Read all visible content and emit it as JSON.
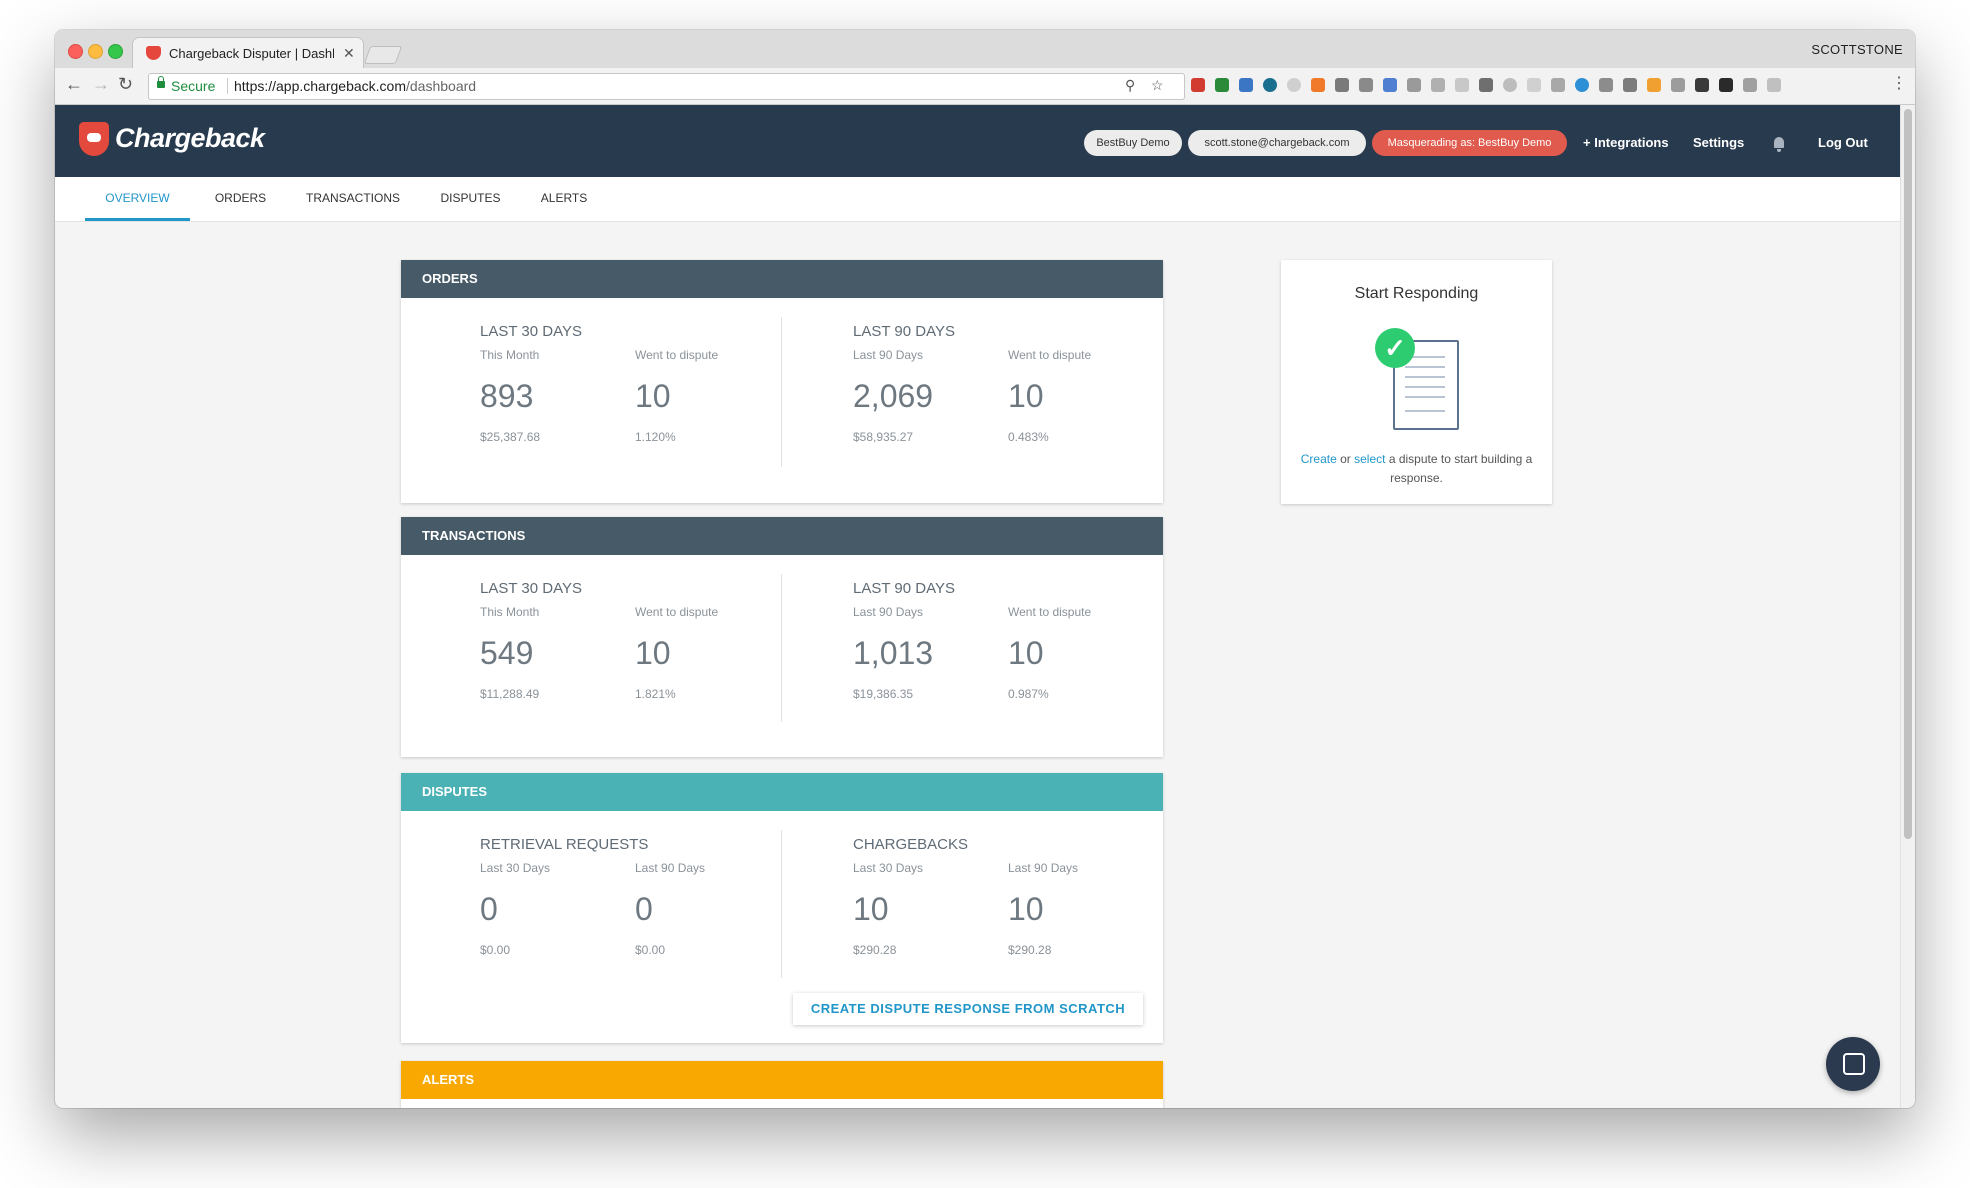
{
  "browser": {
    "tab_title": "Chargeback Disputer | Dashboard",
    "profile_name": "SCOTTSTONE",
    "secure_label": "Secure",
    "url_host": "https://app.chargeback.com",
    "url_path": "/dashboard"
  },
  "header": {
    "logo_text": "Chargeback",
    "pill_account": "BestBuy Demo",
    "pill_email": "scott.stone@chargeback.com",
    "pill_masquerade": "Masquerading as: BestBuy Demo",
    "integrations": "+ Integrations",
    "settings": "Settings",
    "logout": "Log Out"
  },
  "tabs": [
    "OVERVIEW",
    "ORDERS",
    "TRANSACTIONS",
    "DISPUTES",
    "ALERTS"
  ],
  "orders": {
    "header": "ORDERS",
    "left": {
      "title": "LAST 30 DAYS",
      "col1_label": "This Month",
      "col1_value": "893",
      "col1_sub": "$25,387.68",
      "col2_label": "Went to dispute",
      "col2_value": "10",
      "col2_sub": "1.120%"
    },
    "right": {
      "title": "LAST 90 DAYS",
      "col1_label": "Last 90 Days",
      "col1_value": "2,069",
      "col1_sub": "$58,935.27",
      "col2_label": "Went to dispute",
      "col2_value": "10",
      "col2_sub": "0.483%"
    }
  },
  "transactions": {
    "header": "TRANSACTIONS",
    "left": {
      "title": "LAST 30 DAYS",
      "col1_label": "This Month",
      "col1_value": "549",
      "col1_sub": "$11,288.49",
      "col2_label": "Went to dispute",
      "col2_value": "10",
      "col2_sub": "1.821%"
    },
    "right": {
      "title": "LAST 90 DAYS",
      "col1_label": "Last 90 Days",
      "col1_value": "1,013",
      "col1_sub": "$19,386.35",
      "col2_label": "Went to dispute",
      "col2_value": "10",
      "col2_sub": "0.987%"
    }
  },
  "disputes": {
    "header": "DISPUTES",
    "left": {
      "title": "RETRIEVAL REQUESTS",
      "col1_label": "Last 30 Days",
      "col1_value": "0",
      "col1_sub": "$0.00",
      "col2_label": "Last 90 Days",
      "col2_value": "0",
      "col2_sub": "$0.00"
    },
    "right": {
      "title": "CHARGEBACKS",
      "col1_label": "Last 30 Days",
      "col1_value": "10",
      "col1_sub": "$290.28",
      "col2_label": "Last 90 Days",
      "col2_value": "10",
      "col2_sub": "$290.28"
    },
    "create_button": "CREATE DISPUTE RESPONSE FROM SCRATCH"
  },
  "alerts": {
    "header": "ALERTS"
  },
  "side": {
    "title": "Start Responding",
    "create_link": "Create",
    "or_text": " or ",
    "select_link": "select",
    "rest_text": " a dispute to start building a response."
  },
  "colors": {
    "header_bg": "#283a4e",
    "accent_blue": "#2196c9",
    "masquerade_red": "#e05a4d",
    "orders_header": "#475a67",
    "disputes_header": "#4ab1b4",
    "alerts_header": "#f8a800",
    "check_green": "#2ecc71"
  },
  "icons": {
    "back": "arrow-left-icon",
    "forward": "arrow-right-icon",
    "reload": "reload-icon",
    "zoom": "zoom-icon",
    "star": "star-icon",
    "bell": "bell-icon",
    "chat": "chat-icon",
    "menu": "more-vertical-icon",
    "check": "check-icon",
    "receipt": "receipt-icon"
  }
}
